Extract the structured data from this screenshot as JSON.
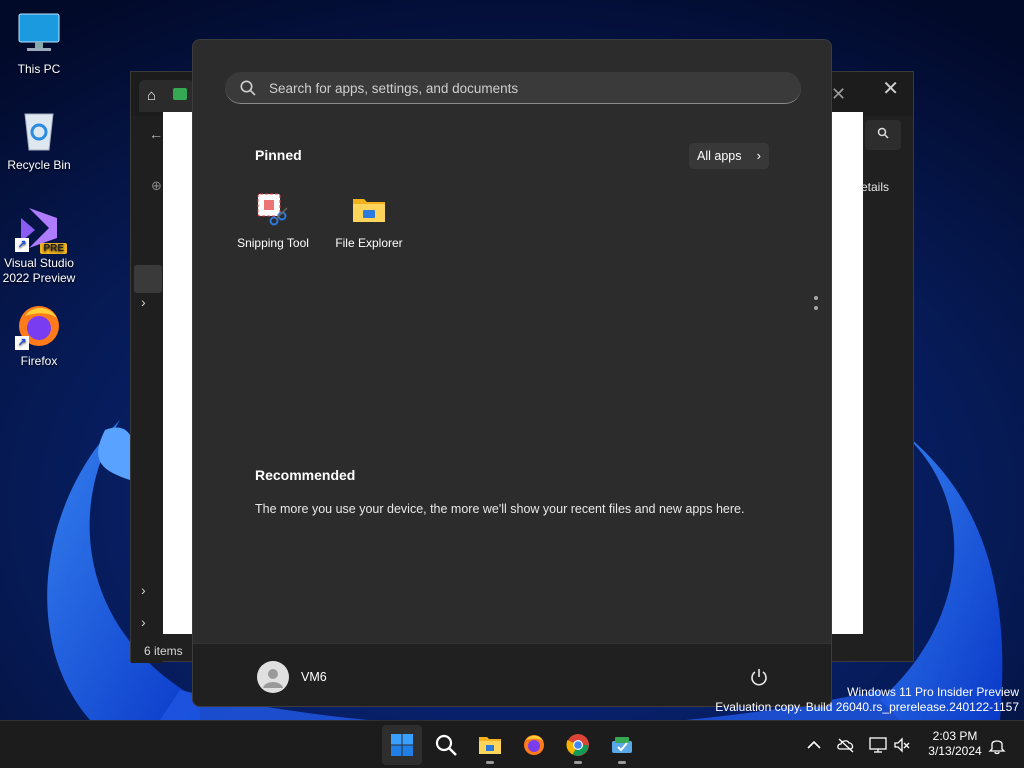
{
  "desktop": {
    "icons": [
      {
        "label": "This PC"
      },
      {
        "label": "Recycle Bin"
      },
      {
        "label_line1": "Visual Studio",
        "label_line2": "2022 Preview",
        "badge": "PRE"
      },
      {
        "label": "Firefox"
      }
    ]
  },
  "explorer": {
    "details_label": "etails",
    "status": "6 items"
  },
  "start_menu": {
    "search": {
      "placeholder": "Search for apps, settings, and documents"
    },
    "pinned": {
      "title": "Pinned",
      "all_apps_label": "All apps",
      "apps": [
        {
          "label": "Snipping Tool",
          "icon": "snipping-tool-icon"
        },
        {
          "label": "File Explorer",
          "icon": "file-explorer-icon"
        }
      ]
    },
    "recommended": {
      "title": "Recommended",
      "message": "The more you use your device, the more we'll show your recent files and new apps here."
    },
    "user": {
      "name": "VM6"
    }
  },
  "watermark": {
    "line1": "Windows 11 Pro Insider Preview",
    "line2": "Evaluation copy. Build 26040.rs_prerelease.240122-1157"
  },
  "taskbar": {
    "apps": [
      "start-icon",
      "search-icon",
      "file-explorer-icon",
      "firefox-icon",
      "chrome-icon",
      "task-app-icon"
    ],
    "clock": {
      "time": "2:03 PM",
      "date": "3/13/2024"
    }
  },
  "colors": {
    "start_bg": "#2c2c2c",
    "taskbar_bg": "#1c1c1c",
    "accent": "#0078d4"
  }
}
